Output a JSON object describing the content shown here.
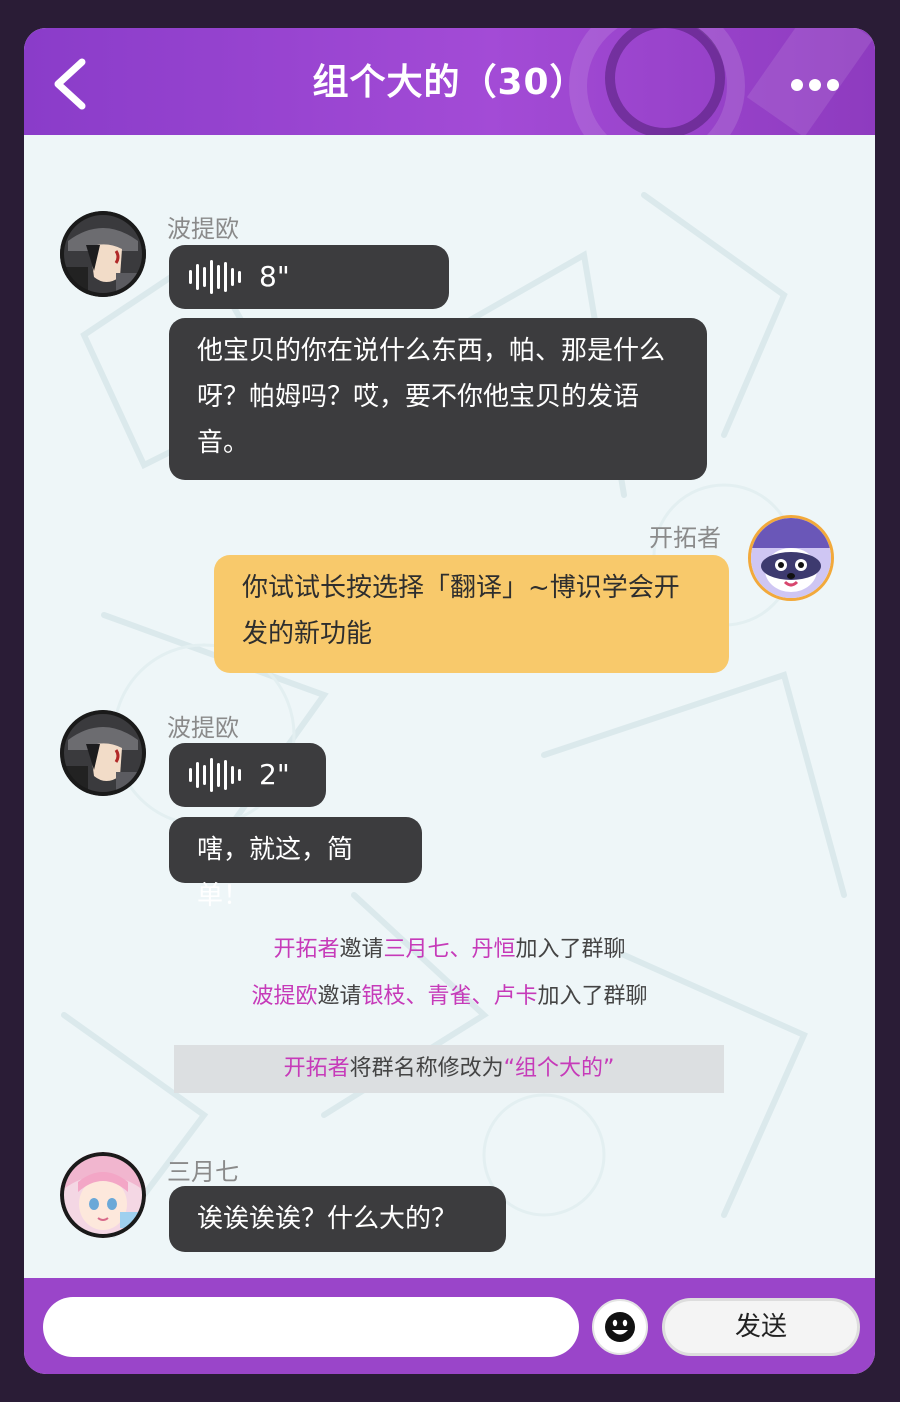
{
  "header": {
    "title": "组个大的（30）"
  },
  "messages": [
    {
      "sender": "波提欧",
      "voice_duration": "8\"",
      "text": "他宝贝的你在说什么东西，帕、那是什么呀？帕姆吗？哎，要不你他宝贝的发语音。"
    },
    {
      "sender": "开拓者",
      "text": "你试试长按选择「翻译」~博识学会开发的新功能"
    },
    {
      "sender": "波提欧",
      "voice_duration": "2\"",
      "text": "嗐，就这，简单！"
    },
    {
      "sender": "三月七",
      "text": "诶诶诶诶？什么大的？"
    }
  ],
  "system": {
    "line1": {
      "actor": "开拓者",
      "verb": "邀请",
      "targets": "三月七、丹恒",
      "suffix": "加入了群聊"
    },
    "line2": {
      "actor": "波提欧",
      "verb": "邀请",
      "targets": "银枝、青雀、卢卡",
      "suffix": "加入了群聊"
    },
    "line3": {
      "actor": "开拓者",
      "middle": "将群名称修改为",
      "new_name": "“组个大的”"
    }
  },
  "composer": {
    "input_value": "",
    "send_label": "发送"
  },
  "colors": {
    "header_purple": "#a34bd6",
    "bottom_purple": "#9a45c9",
    "dark_bubble": "#3c3c3e",
    "gold_bubble": "#f8c96b",
    "highlight_pink": "#c63ab9"
  },
  "icons": [
    "back-chevron-icon",
    "more-dots-icon",
    "voice-wave-icon",
    "emoji-face-icon"
  ]
}
